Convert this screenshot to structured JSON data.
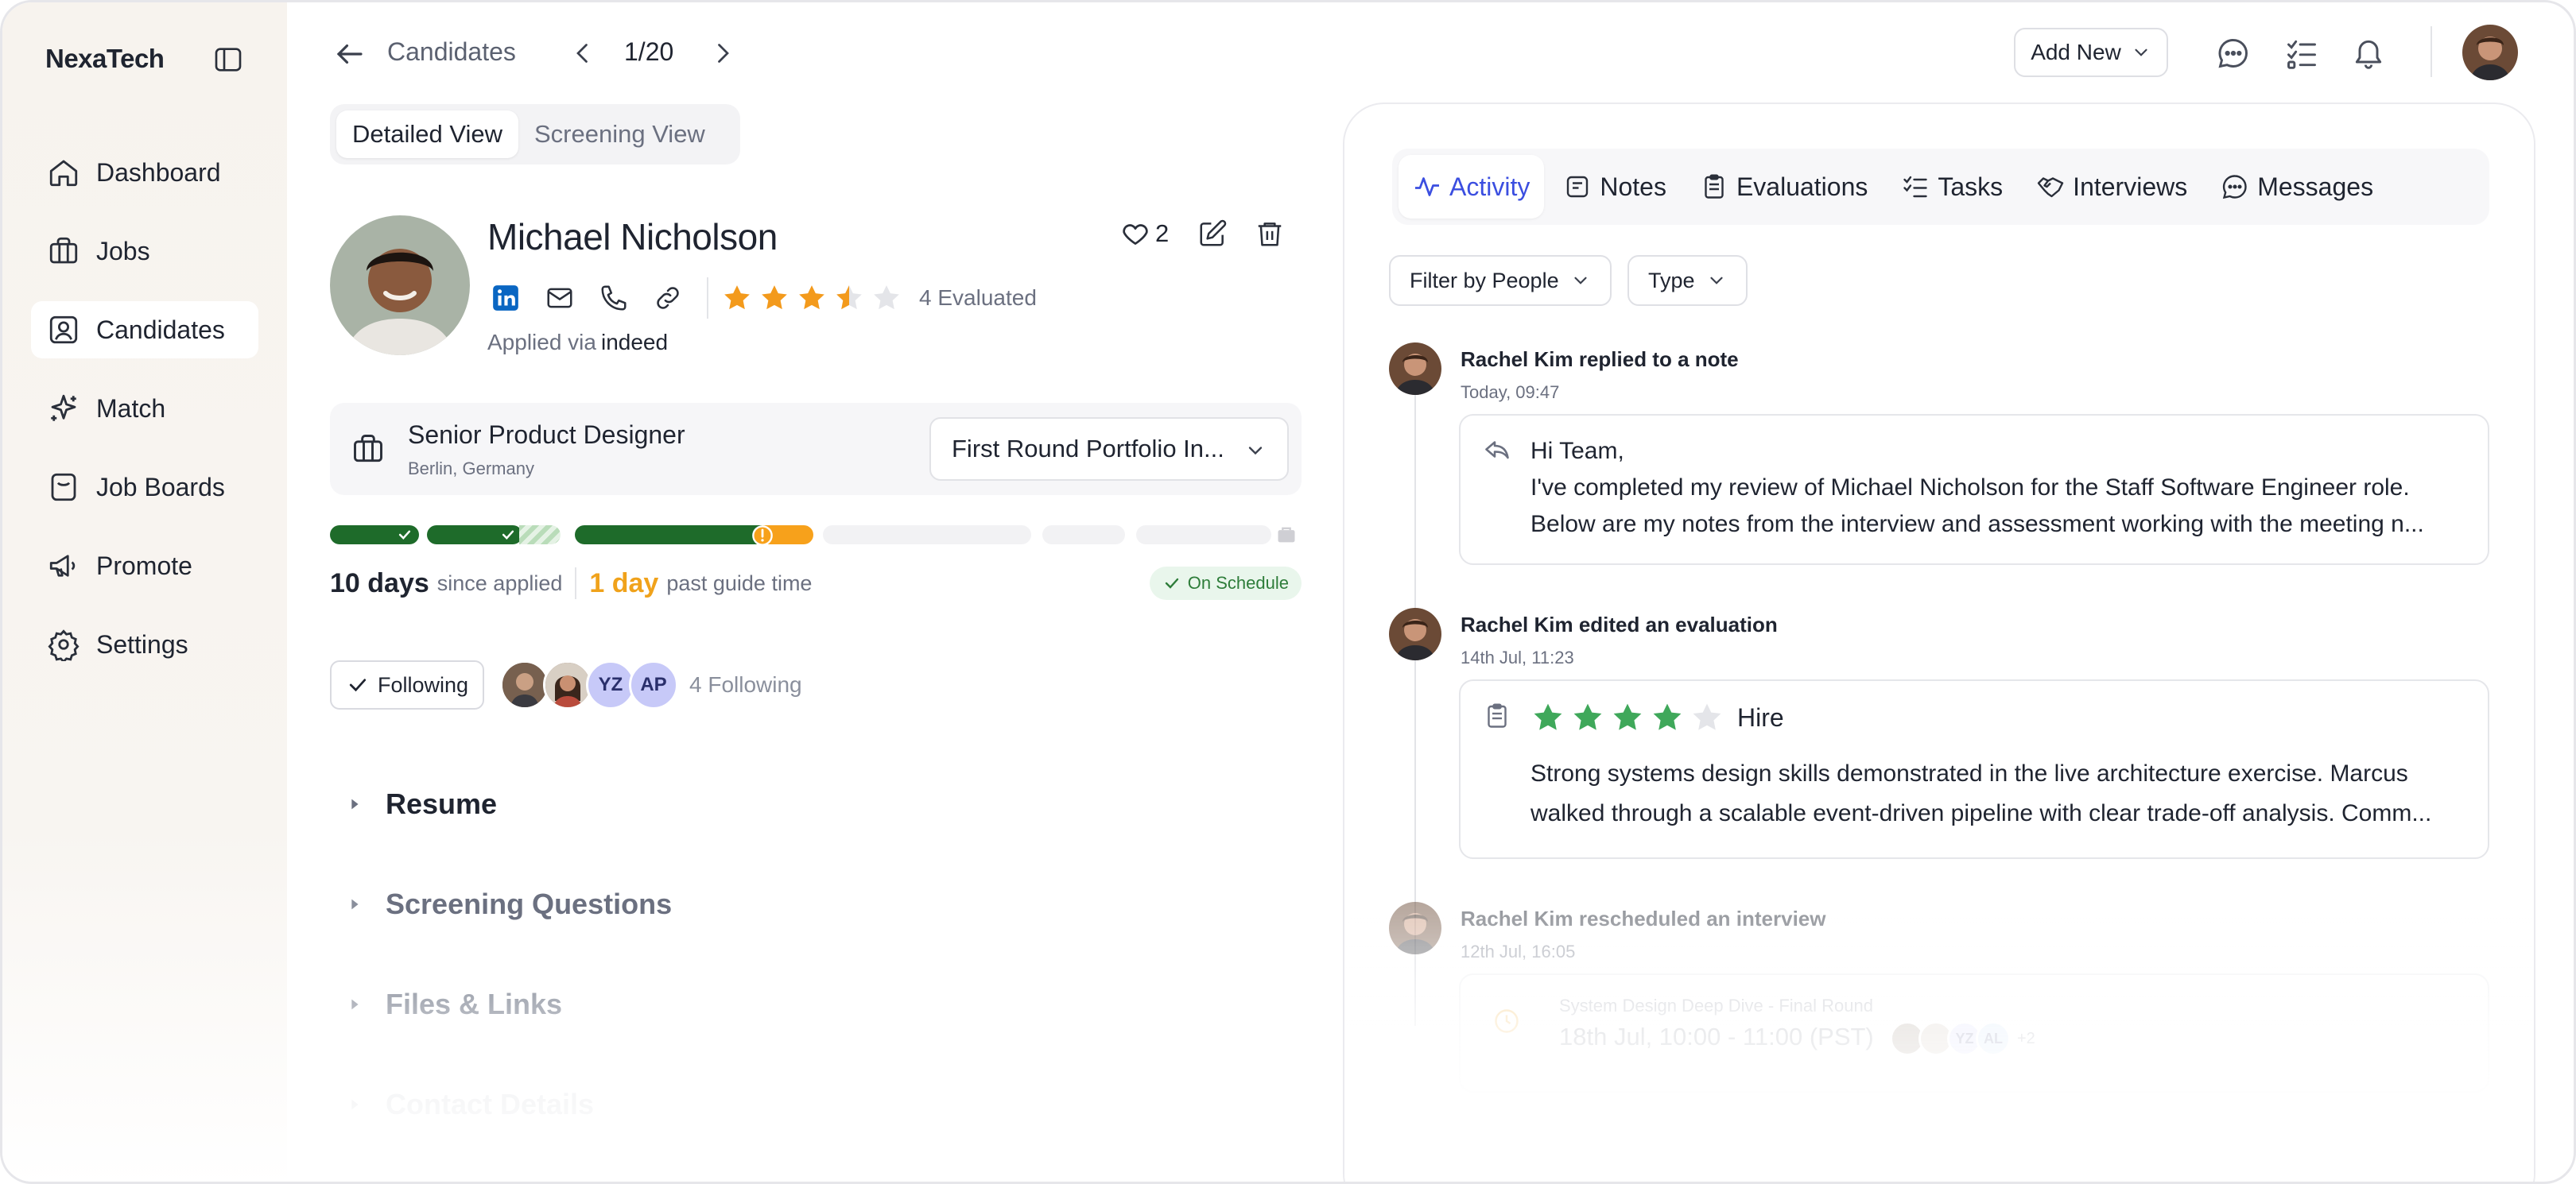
{
  "brand": "NexaTech",
  "sidebar": {
    "items": [
      {
        "label": "Dashboard",
        "icon": "home-icon"
      },
      {
        "label": "Jobs",
        "icon": "briefcase-icon"
      },
      {
        "label": "Candidates",
        "icon": "user-card-icon",
        "active": true
      },
      {
        "label": "Match",
        "icon": "sparkle-icon"
      },
      {
        "label": "Job Boards",
        "icon": "board-icon"
      },
      {
        "label": "Promote",
        "icon": "megaphone-icon"
      },
      {
        "label": "Settings",
        "icon": "gear-icon"
      }
    ]
  },
  "topbar": {
    "breadcrumb": "Candidates",
    "pagination": "1/20",
    "add_new": "Add New"
  },
  "view_tabs": [
    "Detailed View",
    "Screening View"
  ],
  "candidate": {
    "name": "Michael Nicholson",
    "likes": "2",
    "rating": 3.5,
    "evaluated": "4 Evaluated",
    "applied_label": "Applied via",
    "applied_source": "indeed"
  },
  "job": {
    "title": "Senior Product Designer",
    "location": "Berlin, Germany",
    "stage": "First Round Portfolio In..."
  },
  "timing": {
    "days": "10 days",
    "days_label": "since applied",
    "overdue": "1 day",
    "overdue_label": "past guide time",
    "status": "On Schedule"
  },
  "following": {
    "button": "Following",
    "avatars": [
      "YZ",
      "AP"
    ],
    "count": "4 Following"
  },
  "sections": [
    "Resume",
    "Screening Questions",
    "Files & Links",
    "Contact Details"
  ],
  "panel": {
    "tabs": [
      "Activity",
      "Notes",
      "Evaluations",
      "Tasks",
      "Interviews",
      "Messages"
    ],
    "filters": [
      "Filter by People",
      "Type"
    ],
    "activities": [
      {
        "title": "Rachel Kim replied to a note",
        "time": "Today, 09:47",
        "lines": [
          "Hi Team,",
          "I've completed my review of Michael Nicholson for the Staff Software Engineer role.",
          "Below are my notes from the interview and assessment working with the meeting n..."
        ]
      },
      {
        "title": "Rachel Kim edited an evaluation",
        "time": "14th Jul, 11:23",
        "rating": 4,
        "verdict": "Hire",
        "lines": [
          "Strong systems design skills demonstrated in the live architecture exercise. Marcus",
          "walked through a scalable event-driven pipeline with clear trade-off analysis. Comm..."
        ]
      },
      {
        "title": "Rachel Kim rescheduled an interview",
        "time": "12th Jul, 16:05",
        "interview_name": "System Design Deep Dive - Final Round",
        "interview_time": "18th Jul, 10:00 - 11:00 (PST)",
        "attendees": [
          "YZ",
          "AL"
        ],
        "more": "+2"
      }
    ]
  },
  "colors": {
    "accent": "#3b4ee0",
    "star": "#f39a1c",
    "eval_star": "#3fa85a",
    "stage_done": "#1e6b2a",
    "stage_current": "#f7a11b"
  }
}
